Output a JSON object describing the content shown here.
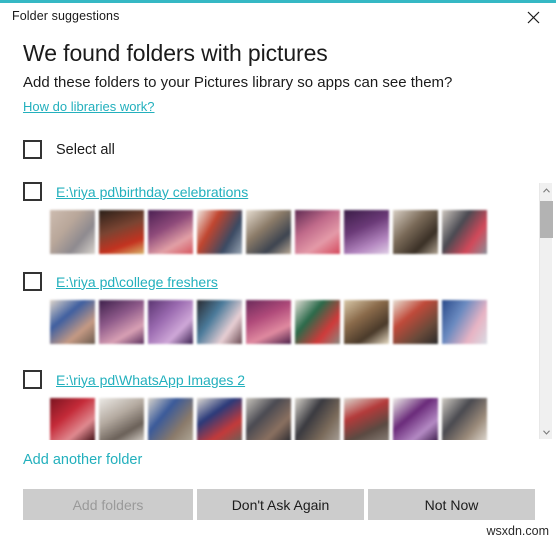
{
  "window": {
    "title": "Folder suggestions",
    "close_icon": "close-icon",
    "accent_color": "#35b8c4"
  },
  "header": {
    "heading": "We found folders with pictures",
    "subheading": "Add these folders to your Pictures library so apps can see them?",
    "help_link": "How do libraries work?"
  },
  "select_all": {
    "label": "Select all",
    "checked": false
  },
  "folders": [
    {
      "path": "E:\\riya pd\\birthday celebrations",
      "checked": false,
      "thumbnails": [
        {
          "name": "thumbnail-1",
          "colors": [
            "#cdbcb0",
            "#b9a79a",
            "#8e8a8f",
            "#d9d4cd"
          ]
        },
        {
          "name": "thumbnail-2",
          "colors": [
            "#2a1f18",
            "#7a4432",
            "#c4321f",
            "#d8b36a"
          ]
        },
        {
          "name": "thumbnail-3",
          "colors": [
            "#4a1f52",
            "#8e4a7a",
            "#e2a0a6",
            "#d6565f"
          ]
        },
        {
          "name": "thumbnail-4",
          "colors": [
            "#f0eae4",
            "#c1452f",
            "#3a4a63",
            "#9aa6b4"
          ]
        },
        {
          "name": "thumbnail-5",
          "colors": [
            "#e7ded2",
            "#8b7b68",
            "#3d4450",
            "#b9a894"
          ]
        },
        {
          "name": "thumbnail-6",
          "colors": [
            "#5e2a52",
            "#c06a8a",
            "#e49aa8",
            "#d4485c"
          ]
        },
        {
          "name": "thumbnail-7",
          "colors": [
            "#3a1c46",
            "#6b3a78",
            "#b487c0",
            "#e0cfe6"
          ]
        },
        {
          "name": "thumbnail-8",
          "colors": [
            "#d8cfc4",
            "#7a6a58",
            "#3a3026",
            "#b0a392"
          ]
        },
        {
          "name": "thumbnail-9",
          "colors": [
            "#cfc8c0",
            "#4a4a52",
            "#d2495a",
            "#8a8f98"
          ]
        }
      ]
    },
    {
      "path": "E:\\riya pd\\college freshers",
      "checked": false,
      "thumbnails": [
        {
          "name": "thumbnail-1",
          "colors": [
            "#dfd6cb",
            "#3f5fa0",
            "#c59a84",
            "#6a5a4e"
          ]
        },
        {
          "name": "thumbnail-2",
          "colors": [
            "#3c1f4a",
            "#8e5a8a",
            "#d8a0b4",
            "#5a2f5e"
          ]
        },
        {
          "name": "thumbnail-3",
          "colors": [
            "#5a3470",
            "#9a6ab0",
            "#cfa8d8",
            "#3a2050"
          ]
        },
        {
          "name": "thumbnail-4",
          "colors": [
            "#2a2a30",
            "#4a7a9a",
            "#e8cfd4",
            "#6a4a52"
          ]
        },
        {
          "name": "thumbnail-5",
          "colors": [
            "#6a2a5a",
            "#b04a7a",
            "#e08aa0",
            "#4a1f48"
          ]
        },
        {
          "name": "thumbnail-6",
          "colors": [
            "#e4e0d8",
            "#2a6a4a",
            "#d03a3a",
            "#8a8a82"
          ]
        },
        {
          "name": "thumbnail-7",
          "colors": [
            "#d8c8a8",
            "#8a6a4a",
            "#4a3a2a",
            "#e8dcc4"
          ]
        },
        {
          "name": "thumbnail-8",
          "colors": [
            "#e8e0d4",
            "#c04a3a",
            "#6a4a3a",
            "#2a2a2a"
          ]
        },
        {
          "name": "thumbnail-9",
          "colors": [
            "#2a4a8a",
            "#6a8ac0",
            "#e8b4c4",
            "#d8dce4"
          ]
        }
      ]
    },
    {
      "path": "E:\\riya pd\\WhatsApp Images 2",
      "checked": false,
      "thumbnails": [
        {
          "name": "thumbnail-1",
          "colors": [
            "#7a1420",
            "#c42a38",
            "#e08a90",
            "#3a0a10"
          ]
        },
        {
          "name": "thumbnail-2",
          "colors": [
            "#eceae6",
            "#b4aaa0",
            "#6a6058",
            "#d8d2ca"
          ]
        },
        {
          "name": "thumbnail-3",
          "colors": [
            "#d8d4cc",
            "#3a5a9a",
            "#8a7a6a",
            "#b0a898"
          ]
        },
        {
          "name": "thumbnail-4",
          "colors": [
            "#e0dcd4",
            "#2a3a7a",
            "#c43a3a",
            "#6a6058"
          ]
        },
        {
          "name": "thumbnail-5",
          "colors": [
            "#c8c4bc",
            "#4a4a52",
            "#8a7060",
            "#2a2a30"
          ]
        },
        {
          "name": "thumbnail-6",
          "colors": [
            "#d8d4cc",
            "#3a3a40",
            "#7a6a5a",
            "#a8a098"
          ]
        },
        {
          "name": "thumbnail-7",
          "colors": [
            "#dcd8d0",
            "#b43a3a",
            "#5a4a42",
            "#8a8078"
          ]
        },
        {
          "name": "thumbnail-8",
          "colors": [
            "#f0eeea",
            "#6a2a7a",
            "#b48ac4",
            "#3a1a48"
          ]
        },
        {
          "name": "thumbnail-9",
          "colors": [
            "#d0ccc4",
            "#4a4a50",
            "#9a8a7a",
            "#e0dad2"
          ]
        }
      ]
    }
  ],
  "scrollbar": {
    "up_arrow_icon": "chevron-up-icon",
    "down_arrow_icon": "chevron-down-icon"
  },
  "add_another_folder": "Add another folder",
  "buttons": {
    "add_folders": "Add folders",
    "dont_ask_again": "Don't Ask Again",
    "not_now": "Not Now"
  },
  "watermark": "wsxdn.com"
}
